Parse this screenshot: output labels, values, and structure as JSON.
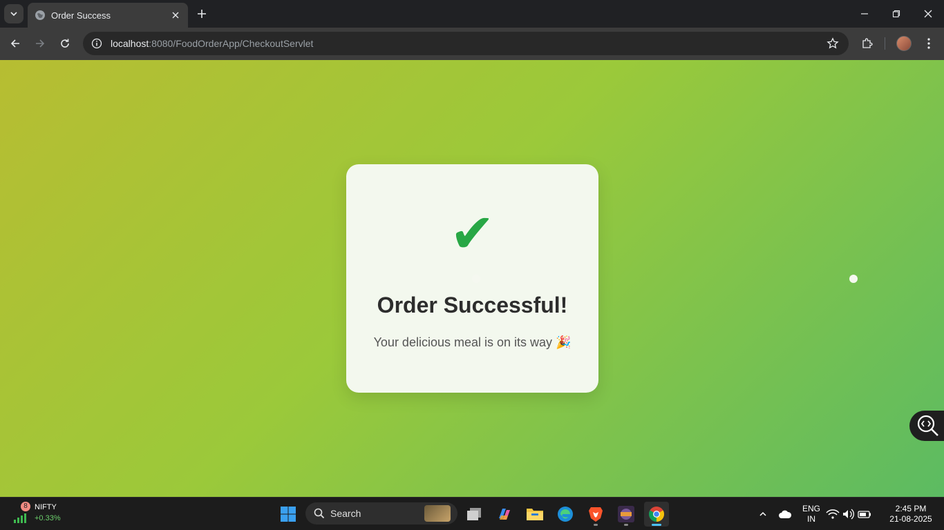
{
  "browser": {
    "tab_title": "Order Success",
    "url_host": "localhost",
    "url_rest": ":8080/FoodOrderApp/CheckoutServlet"
  },
  "page": {
    "heading": "Order Successful!",
    "message": "Your delicious meal is on its way 🎉",
    "check_symbol": "✔"
  },
  "taskbar": {
    "widget_badge": "8",
    "widget_name": "NIFTY",
    "widget_change": "+0.33%",
    "search_label": "Search",
    "language_line1": "ENG",
    "language_line2": "IN",
    "time": "2:45 PM",
    "date": "21-08-2025"
  },
  "colors": {
    "accent_green": "#28a745",
    "page_gradient_start": "#b7bd32",
    "page_gradient_end": "#5cbb62"
  }
}
